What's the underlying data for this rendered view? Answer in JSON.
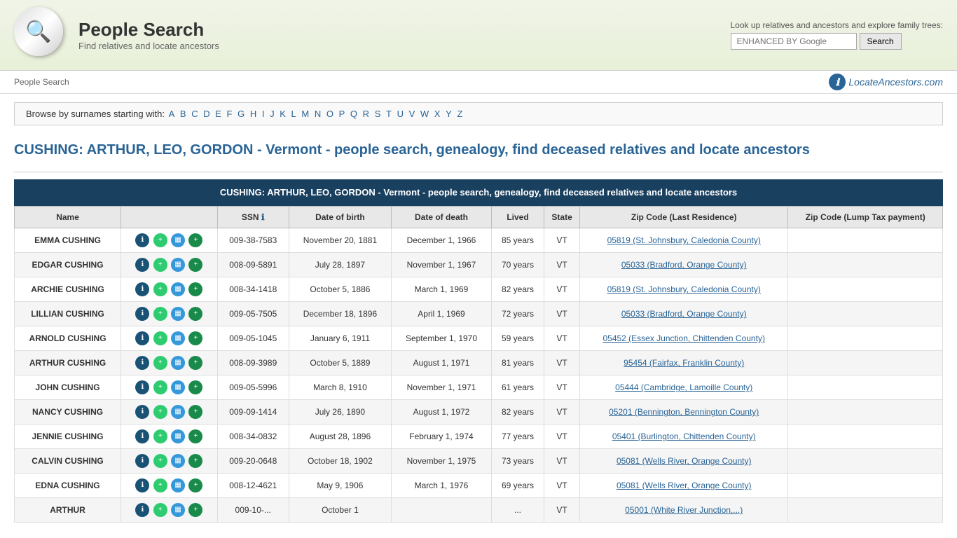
{
  "header": {
    "title": "People Search",
    "subtitle": "Find relatives and locate ancestors",
    "breadcrumb": "People Search",
    "lookup_text": "Look up relatives and ancestors and explore family trees:",
    "search_placeholder": "ENHANCED BY Google",
    "search_button": "Search",
    "locate_ancestors": "LocateAncestors.com"
  },
  "alphabet": {
    "prefix": "Browse by surnames starting with:",
    "letters": [
      "A",
      "B",
      "C",
      "D",
      "E",
      "F",
      "G",
      "H",
      "I",
      "J",
      "K",
      "L",
      "M",
      "N",
      "O",
      "P",
      "Q",
      "R",
      "S",
      "T",
      "U",
      "V",
      "W",
      "X",
      "Y",
      "Z"
    ]
  },
  "page_title": "CUSHING: ARTHUR, LEO, GORDON - Vermont - people search, genealogy, find deceased relatives and locate ancestors",
  "table": {
    "header_title": "CUSHING: ARTHUR, LEO, GORDON - Vermont - people search, genealogy, find deceased relatives and locate ancestors",
    "columns": [
      "Name",
      "",
      "SSN ℹ",
      "Date of birth",
      "Date of death",
      "Lived",
      "State",
      "Zip Code (Last Residence)",
      "Zip Code (Lump Tax payment)"
    ],
    "rows": [
      {
        "name": "EMMA CUSHING",
        "ssn": "009-38-7583",
        "dob": "November 20, 1881",
        "dod": "December 1, 1966",
        "lived": "85 years",
        "state": "VT",
        "zip": "05819 (St. Johnsbury, Caledonia County)",
        "lump": ""
      },
      {
        "name": "EDGAR CUSHING",
        "ssn": "008-09-5891",
        "dob": "July 28, 1897",
        "dod": "November 1, 1967",
        "lived": "70 years",
        "state": "VT",
        "zip": "05033 (Bradford, Orange County)",
        "lump": ""
      },
      {
        "name": "ARCHIE CUSHING",
        "ssn": "008-34-1418",
        "dob": "October 5, 1886",
        "dod": "March 1, 1969",
        "lived": "82 years",
        "state": "VT",
        "zip": "05819 (St. Johnsbury, Caledonia County)",
        "lump": ""
      },
      {
        "name": "LILLIAN CUSHING",
        "ssn": "009-05-7505",
        "dob": "December 18, 1896",
        "dod": "April 1, 1969",
        "lived": "72 years",
        "state": "VT",
        "zip": "05033 (Bradford, Orange County)",
        "lump": ""
      },
      {
        "name": "ARNOLD CUSHING",
        "ssn": "009-05-1045",
        "dob": "January 6, 1911",
        "dod": "September 1, 1970",
        "lived": "59 years",
        "state": "VT",
        "zip": "05452 (Essex Junction, Chittenden County)",
        "lump": ""
      },
      {
        "name": "ARTHUR CUSHING",
        "ssn": "008-09-3989",
        "dob": "October 5, 1889",
        "dod": "August 1, 1971",
        "lived": "81 years",
        "state": "VT",
        "zip": "95454 (Fairfax, Franklin County)",
        "lump": ""
      },
      {
        "name": "JOHN CUSHING",
        "ssn": "009-05-5996",
        "dob": "March 8, 1910",
        "dod": "November 1, 1971",
        "lived": "61 years",
        "state": "VT",
        "zip": "05444 (Cambridge, Lamoille County)",
        "lump": ""
      },
      {
        "name": "NANCY CUSHING",
        "ssn": "009-09-1414",
        "dob": "July 26, 1890",
        "dod": "August 1, 1972",
        "lived": "82 years",
        "state": "VT",
        "zip": "05201 (Bennington, Bennington County)",
        "lump": ""
      },
      {
        "name": "JENNIE CUSHING",
        "ssn": "008-34-0832",
        "dob": "August 28, 1896",
        "dod": "February 1, 1974",
        "lived": "77 years",
        "state": "VT",
        "zip": "05401 (Burlington, Chittenden County)",
        "lump": ""
      },
      {
        "name": "CALVIN CUSHING",
        "ssn": "009-20-0648",
        "dob": "October 18, 1902",
        "dod": "November 1, 1975",
        "lived": "73 years",
        "state": "VT",
        "zip": "05081 (Wells River, Orange County)",
        "lump": ""
      },
      {
        "name": "EDNA CUSHING",
        "ssn": "008-12-4621",
        "dob": "May 9, 1906",
        "dod": "March 1, 1976",
        "lived": "69 years",
        "state": "VT",
        "zip": "05081 (Wells River, Orange County)",
        "lump": ""
      },
      {
        "name": "ARTHUR",
        "ssn": "009-10-...",
        "dob": "October 1",
        "dod": "",
        "lived": "...",
        "state": "VT",
        "zip": "05001 (White River Junction,...)",
        "lump": ""
      }
    ]
  }
}
